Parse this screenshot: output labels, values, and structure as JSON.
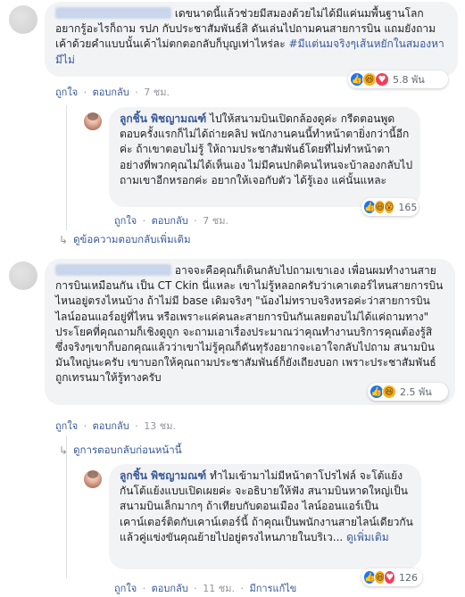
{
  "comments": [
    {
      "author": "",
      "text": "เดขนาดนี้แล้วช่วยมีสมองด้วยไม่ได้มีแค่นมพื้นฐานโลกอยากรู้อะไรก็ถาม รปภ กับประชาสัมพันธ์สิ ดันเล่นไปถามคนสายการบิน แถมยังถามเค้าด้วยคำแบบนั้นเค้าไม่ตกตอกลับก็บุญเท่าไหร่ละ ",
      "hashtag": "#มีแต่นมจริงๆเส้นหยักในสมองหามีไม่",
      "reactions": "5.8 พัน",
      "like": "ถูกใจ",
      "reply": "ตอบกลับ",
      "time": "7 ชม."
    },
    {
      "author": "ลูกชิ้น พิชญามณฑ์",
      "text": "ไปให้สนามบินเปิดกล้องดูค่ะ กรีดตอนพูดตอบครั้งแรกก็ไม่ได้ถ่ายคลิป พนักงานคนนี้ทำหน้าตายิ่งกว่านี้อีกค่ะ ถ้าเขาตอบไม่รู้ ให้ถามประชาสัมพันธ์โดยที่ไม่ทำหน้าตาอย่างที่พวกคุณไม่ได้เห็นเอง ไม่มีคนปกติคนไหนจะบ้าลองกลับไปถามเขาอีกหรอกค่ะ อยากให้เจอกับตัว ได้รู้เอง แค่นั้นแหละ",
      "reactions": "165",
      "like": "ถูกใจ",
      "reply": "ตอบกลับ",
      "time": "7 ชม."
    },
    {
      "author": "",
      "text": "อาจจะคือคุณก็เดินกลับไปถามเขาเอง เพื่อนผมทำงานสายการบินเหมือนกัน เป็น CT Ckin นี่แหละ เขาไม่รู้หลอกครับว่าเคาเตอร์ไหนสายการบินไหนอยู่ตรงไหนบ้าง ถ้าไม่มี base เดิมจริงๆ \"น้องไม่ทราบจริงหรอค่ะว่าสายการบินไลน์ออนแอร์อยู่ที่ไหน หรือเพราะแค่คนละสายการบินกันเลยตอบไม่ได้แค่ถามทาง\" ประโยคที่คุณถามก็เชิงดูถูก จะถามเอาเรื่องประมาณว่าคุณทำงานบริการคุณต้องรู้สิ ซึ่งจริงๆเขาก็บอกคุณแล้วว่าเขาไม่รู้คุณก็ดันทุรังอยากจะเอาใจกลับไปถาม สนามบินมันใหญ่นะครับ เขาบอกให้คุณถามประชาสัมพันธ์ก็ยังเถียงบอก เพราะประชาสัมพันธ์ถูกเทรนมาให้รู้ทางครับ",
      "reactions": "2.5 พัน",
      "like": "ถูกใจ",
      "reply": "ตอบกลับ",
      "time": "13 ชม."
    },
    {
      "author": "ลูกชิ้น พิชญามณฑ์",
      "text": "ทำไมเข้ามาไม่มีหน้าตาโปรไฟล์ จะโต้แย้งกันโต้แย้งแบบเปิดเผยค่ะ จะอธิบายให้ฟัง สนามบินหาดใหญ่เป็นสนามบินเล็กมากๆ ถ้าเทียบกับดอนเมือง ไลน์ออนแอร์เป็นเคาน์เตอร์ติดกับเคาน์เตอร์นี้ ถ้าคุณเป็นพนักงานสายไลน์เดียวกันแล้วคู่แข่งขันคุณย้ายไปอยู่ตรงไหนภายในบริเว...",
      "see_more": "ดูเพิ่มเติม",
      "reactions": "126",
      "like": "ถูกใจ",
      "reply": "ตอบกลับ",
      "time": "11 ชม.",
      "edited": "มีการแก้ไข"
    }
  ],
  "more_replies": "ดูข้อความตอบกลับเพิ่มเติม",
  "previous_replies": "ดูการตอบกลับก่อนหน้านี้",
  "separator": "·"
}
